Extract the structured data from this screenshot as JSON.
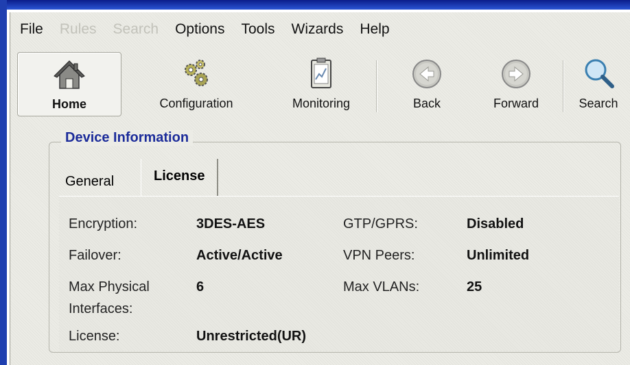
{
  "menu": {
    "items": [
      {
        "label": "File",
        "enabled": true
      },
      {
        "label": "Rules",
        "enabled": false
      },
      {
        "label": "Search",
        "enabled": false
      },
      {
        "label": "Options",
        "enabled": true
      },
      {
        "label": "Tools",
        "enabled": true
      },
      {
        "label": "Wizards",
        "enabled": true
      },
      {
        "label": "Help",
        "enabled": true
      }
    ]
  },
  "toolbar": {
    "home": {
      "label": "Home",
      "icon": "home-icon",
      "active": true
    },
    "configuration": {
      "label": "Configuration",
      "icon": "gears-icon"
    },
    "monitoring": {
      "label": "Monitoring",
      "icon": "clipboard-chart-icon"
    },
    "back": {
      "label": "Back",
      "icon": "back-arrow-icon"
    },
    "forward": {
      "label": "Forward",
      "icon": "forward-arrow-icon"
    },
    "search": {
      "label": "Search",
      "icon": "magnifier-icon"
    }
  },
  "device_info": {
    "title": "Device Information",
    "tabs": [
      {
        "label": "General",
        "selected": false
      },
      {
        "label": "License",
        "selected": true
      }
    ],
    "license": {
      "encryption": {
        "label": "Encryption:",
        "value": "3DES-AES"
      },
      "failover": {
        "label": "Failover:",
        "value": "Active/Active"
      },
      "max_physical": {
        "label": "Max Physical\nInterfaces:",
        "label_line1": "Max Physical",
        "label_line2": "Interfaces:",
        "value": "6"
      },
      "license": {
        "label": "License:",
        "value": "Unrestricted(UR)"
      },
      "gtp_gprs": {
        "label": "GTP/GPRS:",
        "value": "Disabled"
      },
      "vpn_peers": {
        "label": "VPN Peers:",
        "value": "Unlimited"
      },
      "max_vlans": {
        "label": "Max VLANs:",
        "value": "25"
      }
    }
  },
  "colors": {
    "title_blue": "#1c2c9a",
    "window_border": "#1f3fb0",
    "background": "#ecece6"
  }
}
